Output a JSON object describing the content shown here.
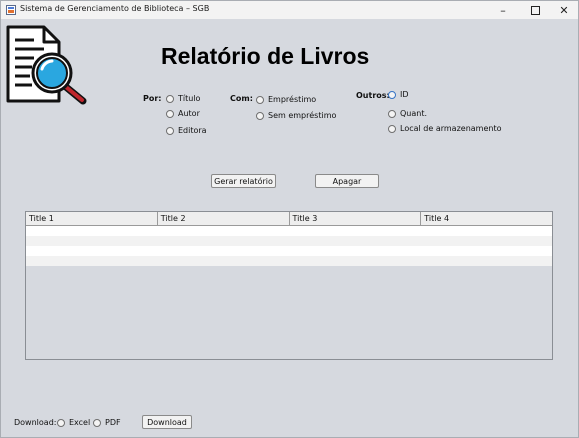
{
  "window": {
    "title": "Sistema de Gerenciamento de Biblioteca – SGB",
    "controls": {
      "minimize": "–",
      "close": "✕"
    }
  },
  "page": {
    "heading": "Relatório de Livros",
    "logo_icon": "document-search-icon"
  },
  "filters": {
    "por": {
      "label": "Por:",
      "options": [
        "Título",
        "Autor",
        "Editora"
      ]
    },
    "com": {
      "label": "Com:",
      "options": [
        "Empréstimo",
        "Sem empréstimo"
      ]
    },
    "outros": {
      "label": "Outros:",
      "options": [
        "ID",
        "Quant.",
        "Local de armazenamento"
      ]
    }
  },
  "actions": {
    "generate": "Gerar relatório",
    "clear": "Apagar"
  },
  "table": {
    "columns": [
      "Title 1",
      "Title 2",
      "Title 3",
      "Title 4"
    ],
    "rows": [
      [
        "",
        "",
        "",
        ""
      ],
      [
        "",
        "",
        "",
        ""
      ],
      [
        "",
        "",
        "",
        ""
      ],
      [
        "",
        "",
        "",
        ""
      ]
    ]
  },
  "download": {
    "label": "Download:",
    "options": [
      "Excel",
      "PDF"
    ],
    "button": "Download"
  },
  "colors": {
    "window_bg": "#d6d9df",
    "titlebar_bg": "#f3f3f3",
    "magnifier_lens": "#2aa7e0",
    "magnifier_handle": "#c0262d"
  }
}
